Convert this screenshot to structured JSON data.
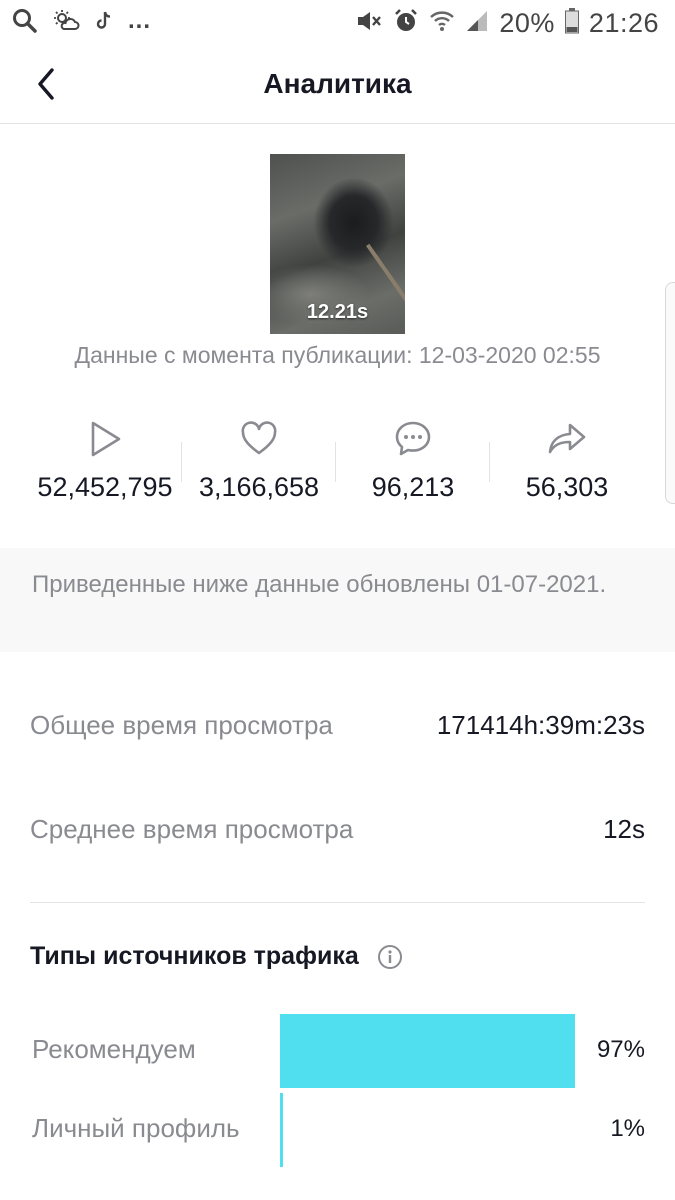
{
  "status_bar": {
    "battery": "20%",
    "time": "21:26",
    "more": "..."
  },
  "header": {
    "title": "Аналитика",
    "back_icon": "chevron-left-icon"
  },
  "video": {
    "duration": "12.21s",
    "since_published": "Данные с момента публикации: 12-03-2020 02:55"
  },
  "stats": [
    {
      "icon": "play-icon",
      "value": "52,452,795"
    },
    {
      "icon": "heart-icon",
      "value": "3,166,658"
    },
    {
      "icon": "comment-icon",
      "value": "96,213"
    },
    {
      "icon": "share-icon",
      "value": "56,303"
    }
  ],
  "notice": "Приведенные ниже данные обновлены 01-07-2021.",
  "metrics": {
    "total_watch_label": "Общее время просмотра",
    "total_watch_value": "171414h:39m:23s",
    "avg_watch_label": "Среднее время просмотра",
    "avg_watch_value": "12s"
  },
  "traffic": {
    "title": "Типы источников трафика",
    "rows": [
      {
        "label": "Рекомендуем",
        "value": "97%",
        "fraction": 0.97
      },
      {
        "label": "Личный профиль",
        "value": "1%",
        "fraction": 0.01
      }
    ]
  },
  "colors": {
    "accent_bar": "#4fdfef",
    "muted_text": "#8a8b91"
  }
}
